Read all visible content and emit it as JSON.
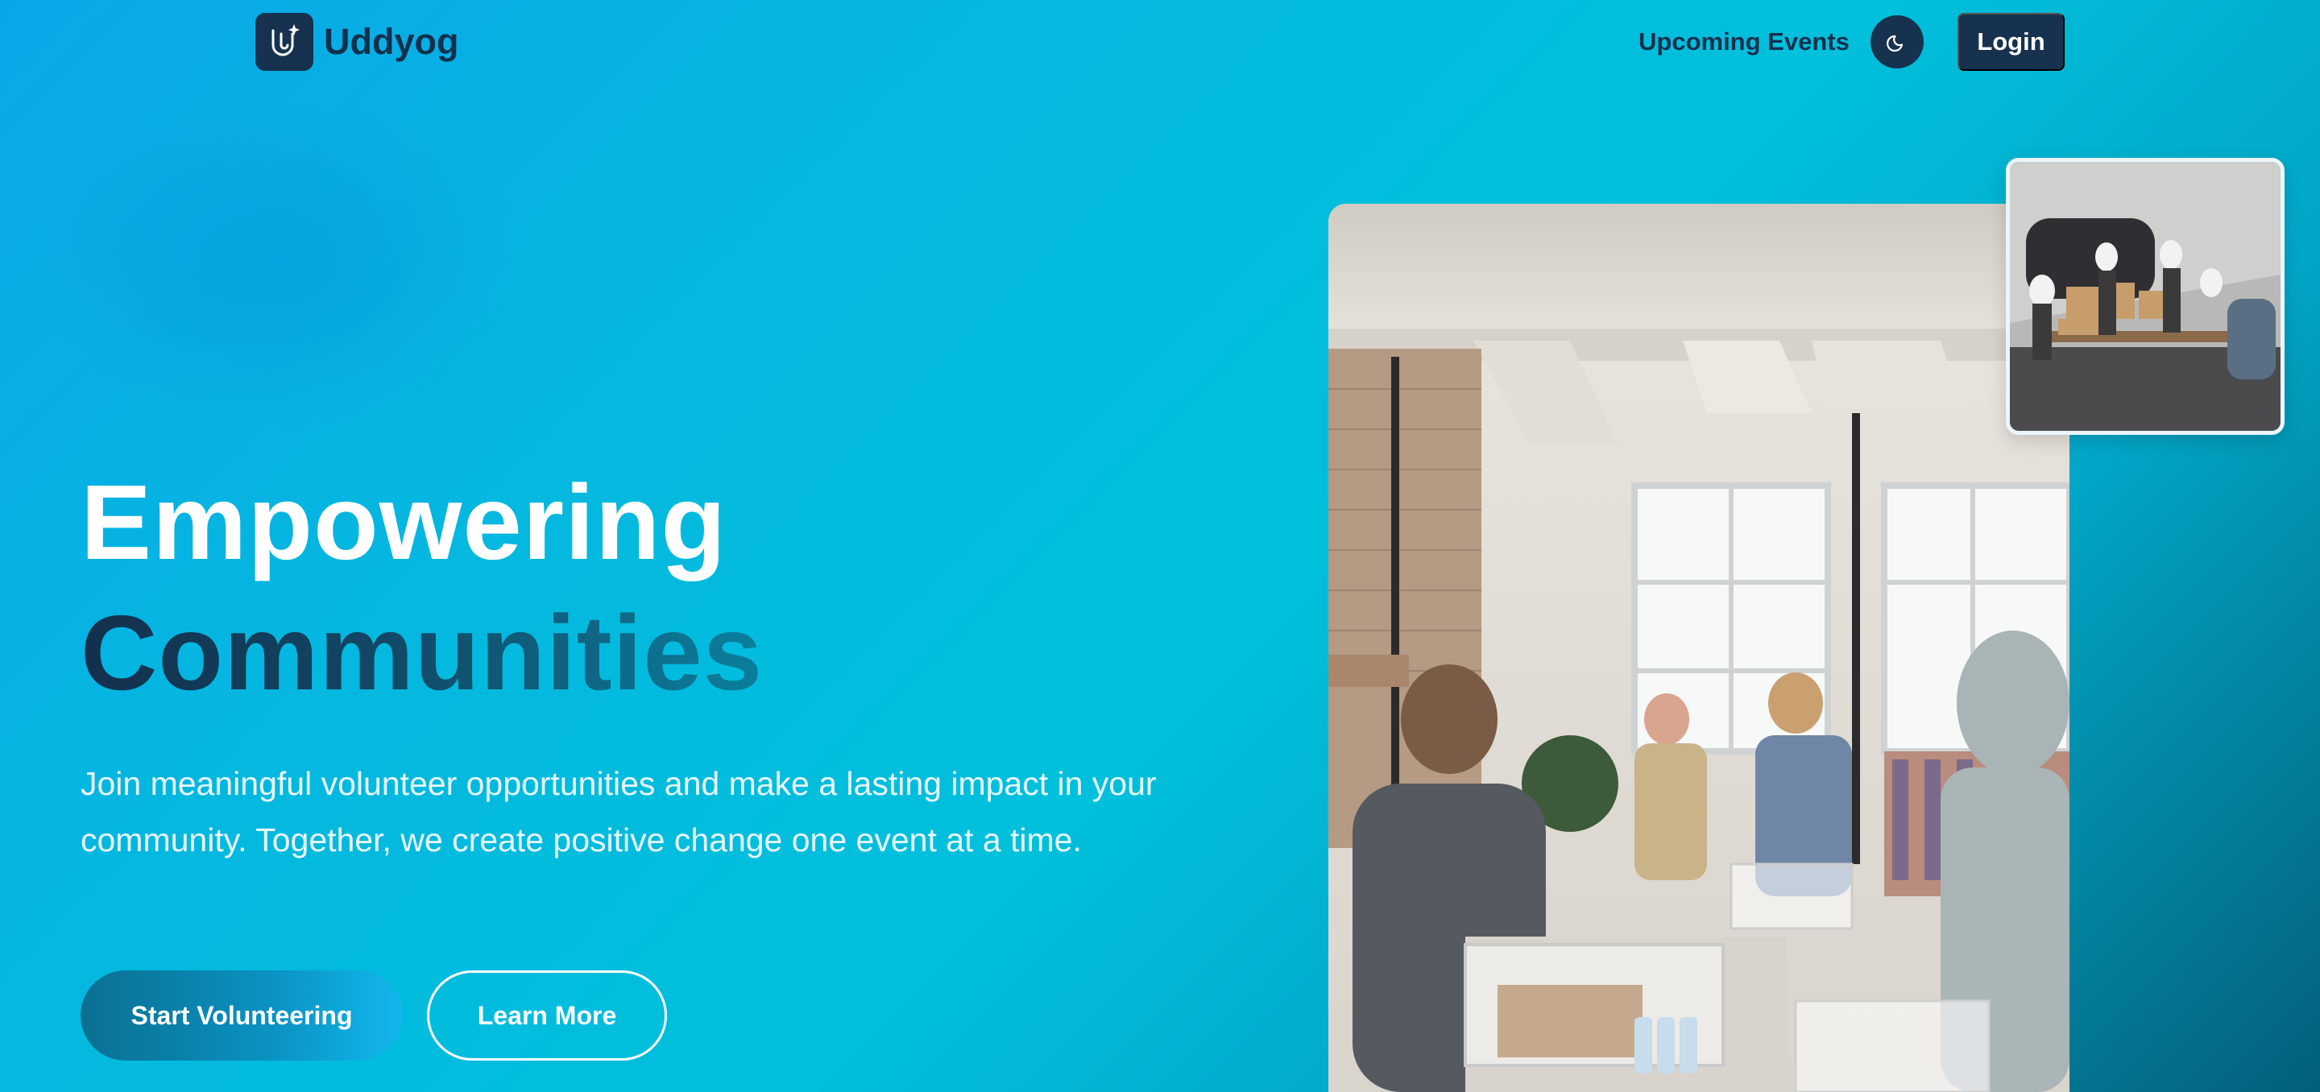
{
  "nav": {
    "brand": "Uddyog",
    "logo_icon": "uddyog-logo-icon",
    "links": [
      "Upcoming Events"
    ],
    "theme_icon": "moon-icon",
    "login_label": "Login"
  },
  "hero": {
    "title_line1": "Empowering",
    "title_line2": "Communities",
    "description": "Join meaningful volunteer opportunities and make a lasting impact in your community. Together, we create positive change one event at a time.",
    "primary_cta": "Start Volunteering",
    "secondary_cta": "Learn More"
  },
  "colors": {
    "navy": "#16324f",
    "cyan": "#00c0dc",
    "accent_blue": "#0a93c2"
  }
}
